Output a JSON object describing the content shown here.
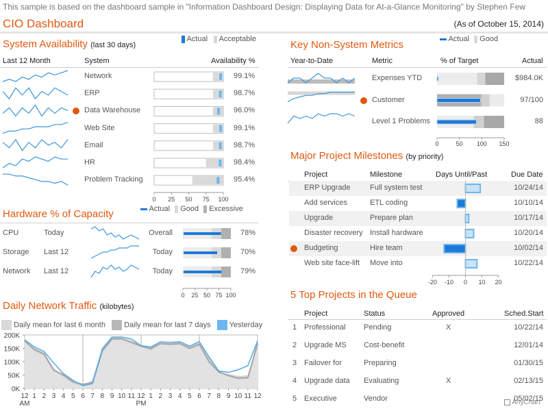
{
  "header": {
    "sample_note": "This sample is based on the dashboard sample in \"Information Dashboard Design: Displaying Data for At-a-Glance Monitoring\" by Stephen Few",
    "title": "CIO Dashboard",
    "as_of": "(As of October 15, 2014)"
  },
  "colors": {
    "accent": "#e2580f",
    "actual": "#1e7ad6",
    "good": "#d9d9d9",
    "excessive": "#b0b0b0",
    "spark": "#3a96dd",
    "yesterday": "#6cb7ef"
  },
  "system_availability": {
    "title": "System Availability",
    "subtitle": "(last 30 days)",
    "legend_actual": "Actual",
    "legend_acceptable": "Acceptable",
    "col_month": "Last 12 Month",
    "col_system": "System",
    "col_avail": "Availability %",
    "axis_ticks": [
      "0",
      "25",
      "50",
      "75",
      "100"
    ],
    "rows": [
      {
        "system": "Network",
        "value": "99.1%",
        "actual": 99.1,
        "acceptable": 85,
        "alert": false
      },
      {
        "system": "ERP",
        "value": "98.7%",
        "actual": 98.7,
        "acceptable": 85,
        "alert": false
      },
      {
        "system": "Data Warehouse",
        "value": "96.0%",
        "actual": 96.0,
        "acceptable": 85,
        "alert": true
      },
      {
        "system": "Web Site",
        "value": "99.1%",
        "actual": 99.1,
        "acceptable": 85,
        "alert": false
      },
      {
        "system": "Email",
        "value": "98.7%",
        "actual": 98.7,
        "acceptable": 85,
        "alert": false
      },
      {
        "system": "HR",
        "value": "98.4%",
        "actual": 98.4,
        "acceptable": 75,
        "alert": false
      },
      {
        "system": "Problem Tracking",
        "value": "95.4%",
        "actual": 95.4,
        "acceptable": 55,
        "alert": false
      }
    ]
  },
  "hardware": {
    "title": "Hardware % of Capacity",
    "legend_actual": "Actual",
    "legend_good": "Good",
    "legend_excessive": "Excessive",
    "axis_ticks": [
      "0",
      "25",
      "50",
      "75",
      "100"
    ],
    "rows": [
      {
        "name": "CPU",
        "period": "Today",
        "scope": "Overall",
        "value": "78%",
        "actual": 78
      },
      {
        "name": "Storage",
        "period": "Last 12",
        "scope": "Today",
        "value": "70%",
        "actual": 70
      },
      {
        "name": "Network",
        "period": "Last 12",
        "scope": "Today",
        "value": "79%",
        "actual": 79
      }
    ]
  },
  "metrics": {
    "title": "Key Non-System Metrics",
    "legend_actual": "Actual",
    "legend_good": "Good",
    "col_ytd": "Year-to-Date",
    "col_metric": "Metric",
    "col_target": "% of Target",
    "col_actual": "Actual",
    "axis_ticks": [
      "0",
      "50",
      "100",
      "150"
    ],
    "rows": [
      {
        "metric": "Expenses YTD",
        "actual": "$984.0K",
        "pct": 2,
        "alert": false
      },
      {
        "metric": "Customer",
        "actual": "97/100",
        "pct": 97,
        "alert": true
      },
      {
        "metric": "Level 1 Problems",
        "actual": "88",
        "pct": 88,
        "alert": false
      }
    ]
  },
  "milestones": {
    "title": "Major Project Milestones",
    "subtitle": "(by priority)",
    "col_project": "Project",
    "col_milestone": "Milestone",
    "col_days": "Days Until/Past",
    "col_due": "Due Date",
    "axis_ticks": [
      "-20",
      "-10",
      "0",
      "10",
      "20"
    ],
    "rows": [
      {
        "project": "ERP Upgrade",
        "milestone": "Full system test",
        "due": "10/24/14",
        "days": 9,
        "alert": false
      },
      {
        "project": "Add services",
        "milestone": "ETL coding",
        "due": "10/10/14",
        "days": -5,
        "alert": false
      },
      {
        "project": "Upgrade",
        "milestone": "Prepare plan",
        "due": "10/17/14",
        "days": 2,
        "alert": false
      },
      {
        "project": "Disaster recovery",
        "milestone": "Install hardware",
        "due": "10/20/14",
        "days": 5,
        "alert": false
      },
      {
        "project": "Budgeting",
        "milestone": "Hire team",
        "due": "10/02/14",
        "days": -13,
        "alert": true
      },
      {
        "project": "Web site face-lift",
        "milestone": "Move into",
        "due": "10/22/14",
        "days": 7,
        "alert": false
      }
    ]
  },
  "queue": {
    "title": "5 Top Projects in the Queue",
    "col_project": "Project",
    "col_status": "Status",
    "col_approved": "Approved",
    "col_start": "Sched.Start",
    "rows": [
      {
        "n": "1",
        "project": "Professional",
        "status": "Pending",
        "approved": "X",
        "start": "10/22/14"
      },
      {
        "n": "2",
        "project": "Upgrade MS",
        "status": "Cost-benefit",
        "approved": "",
        "start": "12/01/14"
      },
      {
        "n": "3",
        "project": "Failover for",
        "status": "Preparing",
        "approved": "",
        "start": "01/30/15"
      },
      {
        "n": "4",
        "project": "Upgrade data",
        "status": "Evaluating",
        "approved": "X",
        "start": "02/13/15"
      },
      {
        "n": "5",
        "project": "Executive",
        "status": "Vendor",
        "approved": "",
        "start": "05/02/15"
      }
    ]
  },
  "traffic": {
    "title": "Daily Network Traffic",
    "subtitle": "(kilobytes)",
    "legend_6m": "Daily mean for last 6 month",
    "legend_7d": "Daily mean for last 7 days",
    "legend_yesterday": "Yesterday",
    "watermark": "AnyChart"
  },
  "chart_data": {
    "type": "area",
    "title": "Daily Network Traffic",
    "ylabel": "",
    "ylim": [
      0,
      200000
    ],
    "y_ticks": [
      "0K",
      "50K",
      "100K",
      "150K",
      "200K"
    ],
    "x_labels": [
      "12",
      "1",
      "2",
      "3",
      "4",
      "5",
      "6",
      "7",
      "8",
      "9",
      "10",
      "11",
      "12",
      "1",
      "2",
      "3",
      "4",
      "5",
      "6",
      "7",
      "8",
      "9",
      "10",
      "11",
      "12"
    ],
    "x_sublabels": {
      "0": "AM",
      "12": "PM"
    },
    "series": [
      {
        "name": "Daily mean for last 6 month",
        "values": [
          175000,
          150000,
          132000,
          72000,
          45000,
          20000,
          12000,
          28000,
          150000,
          190000,
          188000,
          178000,
          160000,
          152000,
          170000,
          168000,
          172000,
          155000,
          170000,
          112000,
          58000,
          52000,
          45000,
          47000,
          158000
        ]
      },
      {
        "name": "Daily mean for last 7 days",
        "values": [
          178000,
          145000,
          128000,
          68000,
          50000,
          25000,
          15000,
          22000,
          140000,
          185000,
          186000,
          172000,
          158000,
          148000,
          168000,
          165000,
          168000,
          150000,
          165000,
          100000,
          62000,
          48000,
          38000,
          40000,
          168000
        ]
      },
      {
        "name": "Yesterday",
        "values": [
          182000,
          155000,
          138000,
          95000,
          55000,
          30000,
          10000,
          18000,
          148000,
          192000,
          192000,
          185000,
          160000,
          155000,
          174000,
          172000,
          175000,
          158000,
          175000,
          118000,
          65000,
          60000,
          70000,
          85000,
          178000
        ]
      }
    ]
  }
}
